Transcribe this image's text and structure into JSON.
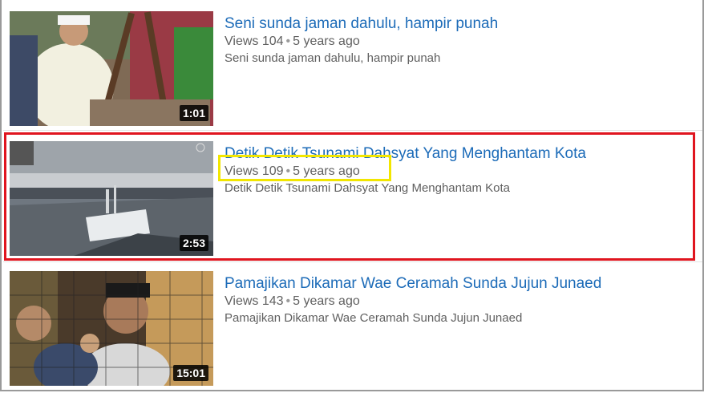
{
  "videos": [
    {
      "title": "Seni sunda jaman dahulu, hampir punah",
      "views": "Views 104",
      "dot": "•",
      "age": "5 years ago",
      "description": "Seni sunda jaman dahulu, hampir punah",
      "duration": "1:01"
    },
    {
      "title": "Detik Detik Tsunami Dahsyat Yang Menghantam Kota",
      "views": "Views 109",
      "dot": "•",
      "age": "5 years ago",
      "description": "Detik Detik Tsunami Dahsyat Yang Menghantam Kota",
      "duration": "2:53"
    },
    {
      "title": "Pamajikan Dikamar Wae Ceramah Sunda Jujun Junaed",
      "views": "Views 143",
      "dot": "•",
      "age": "5 years ago",
      "description": "Pamajikan Dikamar Wae Ceramah Sunda Jujun Junaed",
      "duration": "15:01"
    }
  ],
  "highlight_colors": {
    "selected_item": "#e0151f",
    "selected_meta": "#f2e600"
  },
  "link_color": "#1c6bb8"
}
